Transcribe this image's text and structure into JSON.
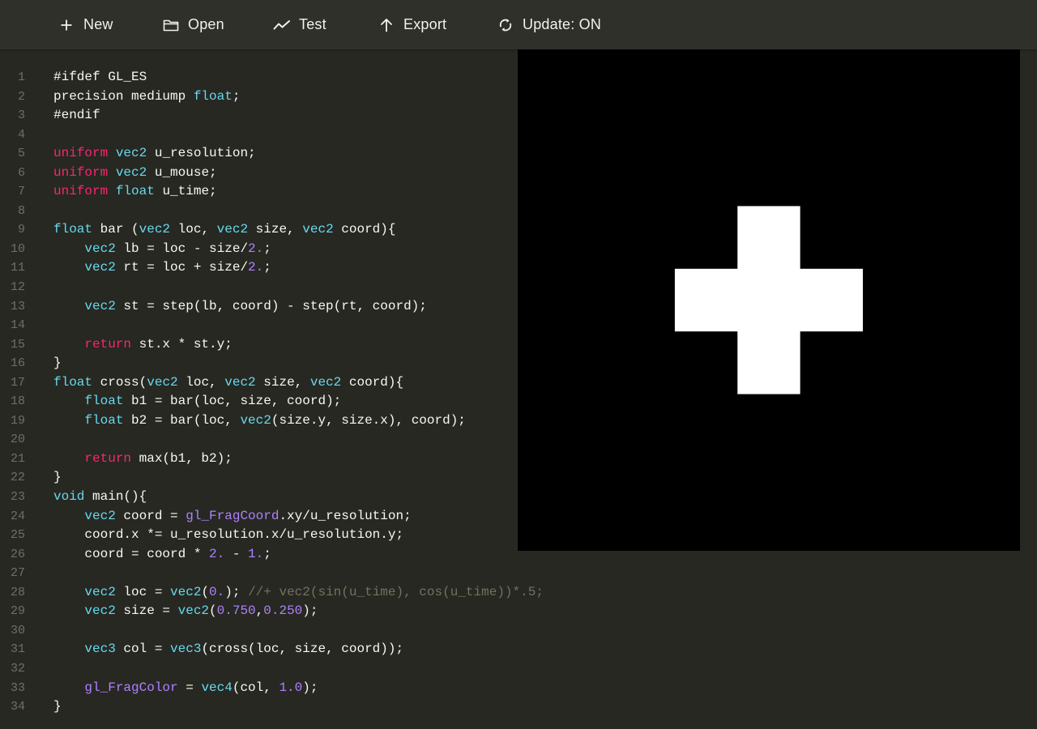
{
  "toolbar": {
    "buttons": [
      {
        "id": "new",
        "label": "New",
        "icon": "plus-icon"
      },
      {
        "id": "open",
        "label": "Open",
        "icon": "folder-icon"
      },
      {
        "id": "test",
        "label": "Test",
        "icon": "line-chart-icon"
      },
      {
        "id": "export",
        "label": "Export",
        "icon": "arrow-up-icon"
      },
      {
        "id": "update",
        "label": "Update: ON",
        "icon": "refresh-icon"
      }
    ]
  },
  "editor": {
    "lines": [
      [
        {
          "t": "#ifdef GL_ES"
        }
      ],
      [
        {
          "t": "precision mediump "
        },
        {
          "t": "float",
          "c": "ty"
        },
        {
          "t": ";"
        }
      ],
      [
        {
          "t": "#endif"
        }
      ],
      [],
      [
        {
          "t": "uniform",
          "c": "kw"
        },
        {
          "t": " "
        },
        {
          "t": "vec2",
          "c": "ty"
        },
        {
          "t": " u_resolution;"
        }
      ],
      [
        {
          "t": "uniform",
          "c": "kw"
        },
        {
          "t": " "
        },
        {
          "t": "vec2",
          "c": "ty"
        },
        {
          "t": " u_mouse;"
        }
      ],
      [
        {
          "t": "uniform",
          "c": "kw"
        },
        {
          "t": " "
        },
        {
          "t": "float",
          "c": "ty"
        },
        {
          "t": " u_time;"
        }
      ],
      [],
      [
        {
          "t": "float",
          "c": "ty"
        },
        {
          "t": " bar ("
        },
        {
          "t": "vec2",
          "c": "ty"
        },
        {
          "t": " loc, "
        },
        {
          "t": "vec2",
          "c": "ty"
        },
        {
          "t": " size, "
        },
        {
          "t": "vec2",
          "c": "ty"
        },
        {
          "t": " coord){"
        }
      ],
      [
        {
          "t": "    "
        },
        {
          "t": "vec2",
          "c": "ty"
        },
        {
          "t": " lb = loc - size/"
        },
        {
          "t": "2.",
          "c": "nm"
        },
        {
          "t": ";"
        }
      ],
      [
        {
          "t": "    "
        },
        {
          "t": "vec2",
          "c": "ty"
        },
        {
          "t": " rt = loc + size/"
        },
        {
          "t": "2.",
          "c": "nm"
        },
        {
          "t": ";"
        }
      ],
      [],
      [
        {
          "t": "    "
        },
        {
          "t": "vec2",
          "c": "ty"
        },
        {
          "t": " st = step(lb, coord) - step(rt, coord);"
        }
      ],
      [],
      [
        {
          "t": "    "
        },
        {
          "t": "return",
          "c": "kw"
        },
        {
          "t": " st.x * st.y;"
        }
      ],
      [
        {
          "t": "}"
        }
      ],
      [
        {
          "t": "float",
          "c": "ty"
        },
        {
          "t": " cross("
        },
        {
          "t": "vec2",
          "c": "ty"
        },
        {
          "t": " loc, "
        },
        {
          "t": "vec2",
          "c": "ty"
        },
        {
          "t": " size, "
        },
        {
          "t": "vec2",
          "c": "ty"
        },
        {
          "t": " coord){"
        }
      ],
      [
        {
          "t": "    "
        },
        {
          "t": "float",
          "c": "ty"
        },
        {
          "t": " b1 = bar(loc, size, coord);"
        }
      ],
      [
        {
          "t": "    "
        },
        {
          "t": "float",
          "c": "ty"
        },
        {
          "t": " b2 = bar(loc, "
        },
        {
          "t": "vec2",
          "c": "ty"
        },
        {
          "t": "(size.y, size.x), coord);"
        }
      ],
      [],
      [
        {
          "t": "    "
        },
        {
          "t": "return",
          "c": "kw"
        },
        {
          "t": " max(b1, b2);"
        }
      ],
      [
        {
          "t": "}"
        }
      ],
      [
        {
          "t": "void",
          "c": "ty"
        },
        {
          "t": " main(){"
        }
      ],
      [
        {
          "t": "    "
        },
        {
          "t": "vec2",
          "c": "ty"
        },
        {
          "t": " coord = "
        },
        {
          "t": "gl_FragCoord",
          "c": "bi"
        },
        {
          "t": ".xy/u_resolution;"
        }
      ],
      [
        {
          "t": "    coord.x *= u_resolution.x/u_resolution.y;"
        }
      ],
      [
        {
          "t": "    coord = coord * "
        },
        {
          "t": "2.",
          "c": "nm"
        },
        {
          "t": " - "
        },
        {
          "t": "1.",
          "c": "nm"
        },
        {
          "t": ";"
        }
      ],
      [],
      [
        {
          "t": "    "
        },
        {
          "t": "vec2",
          "c": "ty"
        },
        {
          "t": " loc = "
        },
        {
          "t": "vec2",
          "c": "ty"
        },
        {
          "t": "("
        },
        {
          "t": "0.",
          "c": "nm"
        },
        {
          "t": "); "
        },
        {
          "t": "//+ vec2(sin(u_time), cos(u_time))*.5;",
          "c": "cm"
        }
      ],
      [
        {
          "t": "    "
        },
        {
          "t": "vec2",
          "c": "ty"
        },
        {
          "t": " size = "
        },
        {
          "t": "vec2",
          "c": "ty"
        },
        {
          "t": "("
        },
        {
          "t": "0.750",
          "c": "nm"
        },
        {
          "t": ","
        },
        {
          "t": "0.250",
          "c": "nm"
        },
        {
          "t": ");"
        }
      ],
      [],
      [
        {
          "t": "    "
        },
        {
          "t": "vec3",
          "c": "ty"
        },
        {
          "t": " col = "
        },
        {
          "t": "vec3",
          "c": "ty"
        },
        {
          "t": "(cross(loc, size, coord));"
        }
      ],
      [],
      [
        {
          "t": "    "
        },
        {
          "t": "gl_FragColor",
          "c": "bi"
        },
        {
          "t": " = "
        },
        {
          "t": "vec4",
          "c": "ty"
        },
        {
          "t": "(col, "
        },
        {
          "t": "1.0",
          "c": "nm"
        },
        {
          "t": ");"
        }
      ],
      [
        {
          "t": "}"
        }
      ]
    ]
  },
  "preview": {
    "background": "#000000",
    "shape_color": "#ffffff",
    "cross_size": [
      0.75,
      0.25
    ],
    "cross_loc": [
      0.0,
      0.0
    ]
  },
  "colors": {
    "editor_bg": "#272822",
    "toolbar_bg": "#2f302a",
    "keyword": "#f92672",
    "type": "#66d9ef",
    "number": "#ae81ff",
    "comment": "#75715e",
    "text": "#f8f8f2"
  }
}
